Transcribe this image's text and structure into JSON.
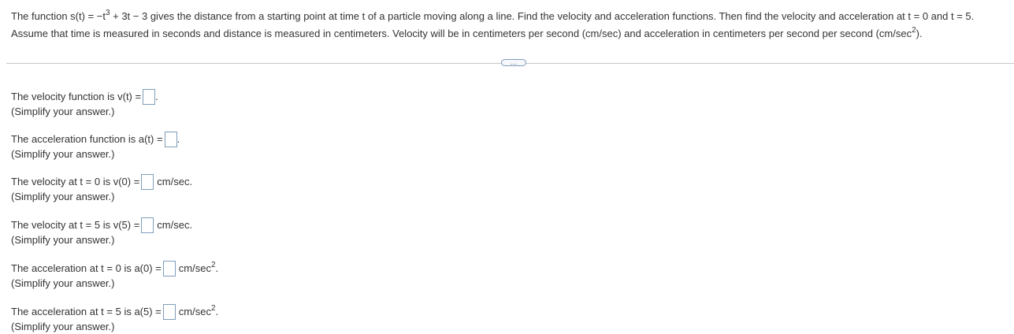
{
  "problem": {
    "line1_a": "The function s(t) = −t",
    "line1_exp": "3",
    "line1_b": " + 3t − 3 gives the distance from a starting point at time t of a particle moving along a line. Find the velocity and acceleration functions. Then find the velocity and acceleration at t = 0 and t = 5.",
    "line2_a": "Assume that time is measured in seconds and distance is measured in centimeters. Velocity will be in centimeters per second (cm/sec) and acceleration in centimeters per second per second (cm/sec",
    "line2_exp": "2",
    "line2_b": ")."
  },
  "more_button": "…",
  "questions": [
    {
      "prompt": "The velocity function is v(t) =",
      "unit": "",
      "unit_exp": "",
      "after": ".",
      "hint": "(Simplify your answer.)"
    },
    {
      "prompt": "The acceleration function is a(t) =",
      "unit": "",
      "unit_exp": "",
      "after": ".",
      "hint": "(Simplify your answer.)"
    },
    {
      "prompt": "The velocity at t = 0 is v(0) =",
      "unit": "cm/sec.",
      "unit_exp": "",
      "after": "",
      "hint": "(Simplify your answer.)"
    },
    {
      "prompt": "The velocity at t = 5 is v(5) =",
      "unit": "cm/sec.",
      "unit_exp": "",
      "after": "",
      "hint": "(Simplify your answer.)"
    },
    {
      "prompt": "The acceleration at t = 0 is a(0) =",
      "unit": "cm/sec",
      "unit_exp": "2",
      "after": ".",
      "hint": "(Simplify your answer.)"
    },
    {
      "prompt": "The acceleration at t = 5 is a(5) =",
      "unit": "cm/sec",
      "unit_exp": "2",
      "after": ".",
      "hint": "(Simplify your answer.)"
    }
  ]
}
